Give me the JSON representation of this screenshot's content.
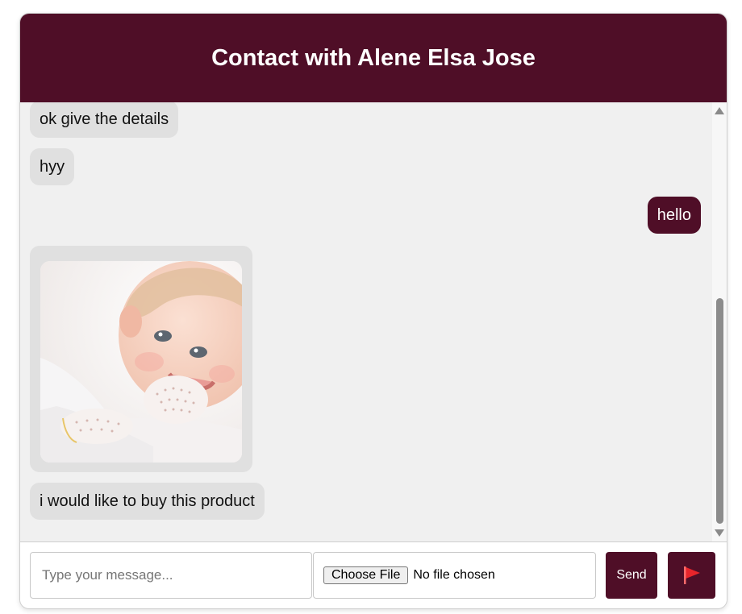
{
  "header": {
    "title": "Contact with Alene Elsa Jose"
  },
  "messages": [
    {
      "type": "received",
      "text": "ok give the details"
    },
    {
      "type": "received",
      "text": "hyy"
    },
    {
      "type": "sent",
      "text": "hello"
    },
    {
      "type": "received-image",
      "text": ""
    },
    {
      "type": "received",
      "text": "i would like to buy this product"
    }
  ],
  "composer": {
    "message_placeholder": "Type your message...",
    "choose_file_label": "Choose File",
    "file_status": "No file chosen",
    "send_label": "Send",
    "flag_icon": "flag-icon"
  },
  "colors": {
    "brand": "#4f0e27",
    "received_bubble": "#e0e0e0",
    "background": "#f0f0f0"
  }
}
